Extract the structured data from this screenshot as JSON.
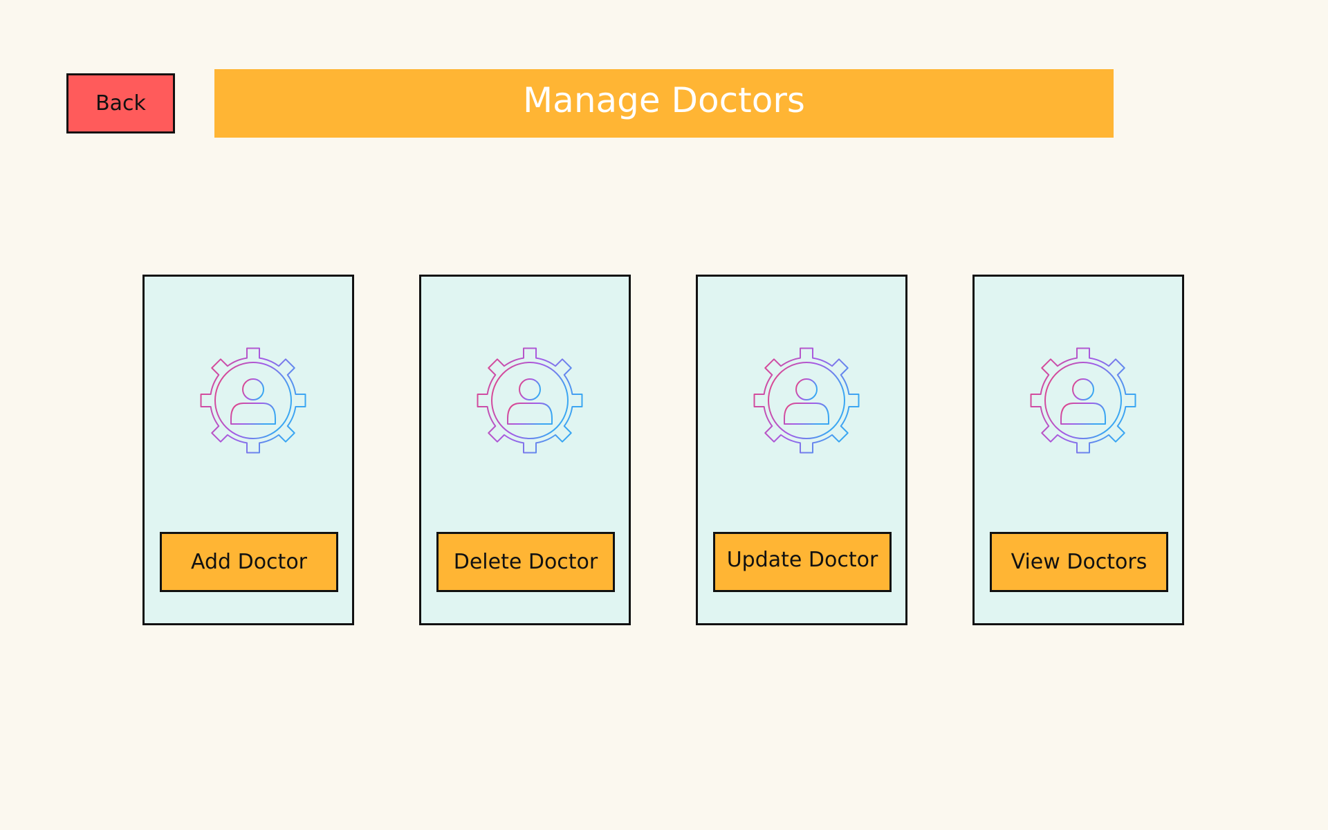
{
  "header": {
    "back_label": "Back",
    "title": "Manage Doctors"
  },
  "cards": [
    {
      "label": "Add Doctor",
      "icon": "user-gear-icon"
    },
    {
      "label": "Delete Doctor",
      "icon": "user-gear-icon"
    },
    {
      "label": "Update Doctor",
      "icon": "user-gear-icon"
    },
    {
      "label": "View Doctors",
      "icon": "user-gear-icon"
    }
  ],
  "colors": {
    "background": "#fbf8ef",
    "accent": "#ffb534",
    "back_button": "#ff5b5b",
    "card_background": "#e0f5f2",
    "icon_gradient_start": "#e9437a",
    "icon_gradient_mid": "#a35be6",
    "icon_gradient_end": "#3aa6f2"
  }
}
